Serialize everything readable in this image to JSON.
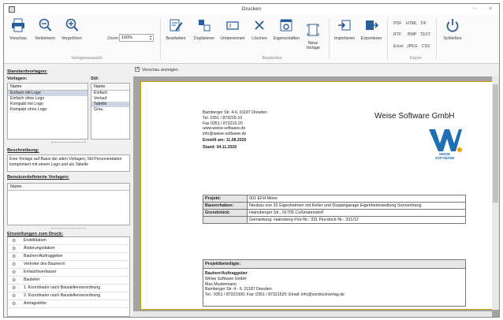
{
  "window": {
    "title": "Drucken",
    "min": "─",
    "close": "✕"
  },
  "ribbon": {
    "buttons": [
      {
        "label": "Vorschau",
        "icon": "printer-icon"
      },
      {
        "label": "Verkleinern",
        "icon": "zoom-out-icon"
      },
      {
        "label": "Vergrößern",
        "icon": "zoom-in-icon"
      },
      {
        "label": "Bearbeiten",
        "icon": "edit-icon"
      },
      {
        "label": "Duplizieren",
        "icon": "duplicate-icon"
      },
      {
        "label": "Umbenennen",
        "icon": "rename-icon"
      },
      {
        "label": "Löschen",
        "icon": "delete-icon"
      },
      {
        "label": "Eigenschaften",
        "icon": "properties-icon"
      },
      {
        "label": "Neue\nVorlage",
        "icon": "new-template-icon"
      },
      {
        "label": "Importieren",
        "icon": "import-icon"
      },
      {
        "label": "Exportieren",
        "icon": "export-icon"
      },
      {
        "label": "Schließen",
        "icon": "power-icon"
      }
    ],
    "zoom_label": "Zoom",
    "zoom_value": "100%",
    "groups": {
      "preview": "Vorlagenauswahl",
      "edit": "Bearbeiten",
      "export": "Export"
    },
    "formats": [
      "PDF",
      "HTML",
      "TIF",
      "RTF",
      "BMP",
      "TEXT",
      "Excel",
      "JPEG",
      "CSV"
    ]
  },
  "left": {
    "standard_heading": "Standardvorlagen:",
    "templates_label": "Vorlagen:",
    "style_label": "Stil:",
    "templates_header": "Name",
    "templates": [
      "Einfach mit Logo",
      "Einfach ohne Logo",
      "Kompakt mit Logo",
      "Kompakt ohne Logo"
    ],
    "templates_selected": 0,
    "styles_header": "Name",
    "styles": [
      "Einfach",
      "Verlauf",
      "Tabelle",
      "Grau"
    ],
    "styles_selected": 2,
    "desc_heading": "Beschreibung:",
    "description": "Eine Vorlage auf Basis der alten Vorlagen; Stil Personendaten komprimiert mit einem Logo und als Tabelle",
    "user_heading": "Benutzerdefinierte Vorlagen:",
    "user_header": "Name",
    "print_heading": "Einstellungen zum Druck:",
    "print_items": [
      "Erstelldatum",
      "Änderungsdatum",
      "Bauherr/Auftraggeber",
      "Vertreter des Bauherrn",
      "Entwurfsverfasser",
      "Bauleiter",
      "1. Koordinator nach Baustellenverordnung",
      "2. Koordinator nach Baustellenverordnung",
      "Antragsteller"
    ]
  },
  "preview": {
    "checkbox_label": "Vorschau anzeigen",
    "address": [
      "Bamberger Str. 4-6, 01187 Dresden",
      "Tel. 0351 / 873215-10",
      "Fax 0351 / 873215-20",
      "www.weise-software.de",
      "info@weise-software.de"
    ],
    "created": "Erstellt am: 11.08.2020",
    "status": "Stand: 04.11.2020",
    "company": "Weise Software GmbH",
    "logo_text_1": "WEISE",
    "logo_text_2": "SOFTWARE",
    "project_rows": [
      {
        "k": "Projekt:",
        "v": "001 EFH Meier"
      },
      {
        "k": "Bauvorhaben:",
        "v": "Neubau von 32 Eigenheimen mit Keller und Doppelgarage Eigenheimsiedlung Sonnenhang"
      },
      {
        "k": "Grundstück:",
        "v": "Hainsberger Str., 01705 Coßmannsdorf"
      },
      {
        "k": "",
        "v": "Gemarkung: Hainsberg Flur-Nr.: 331 Flurstück-Nr.: 331/12"
      }
    ],
    "participants_heading": "Projektbeteiligte:",
    "client_heading": "Bauherr/Auftraggeber",
    "client_lines": [
      "Weise Software GmbH",
      "Max Mustermann",
      "Bamberger Str.  4 - 6,  01187  Dresden",
      "Tel.: 0351 / 87321500;  Fax: 0351 / 87321520; Email: info@vordruckverlag.de"
    ]
  },
  "colors": {
    "accent": "#1f6fb3",
    "page_border": "#c9a200",
    "viewer_bg": "#a3a3a3"
  }
}
